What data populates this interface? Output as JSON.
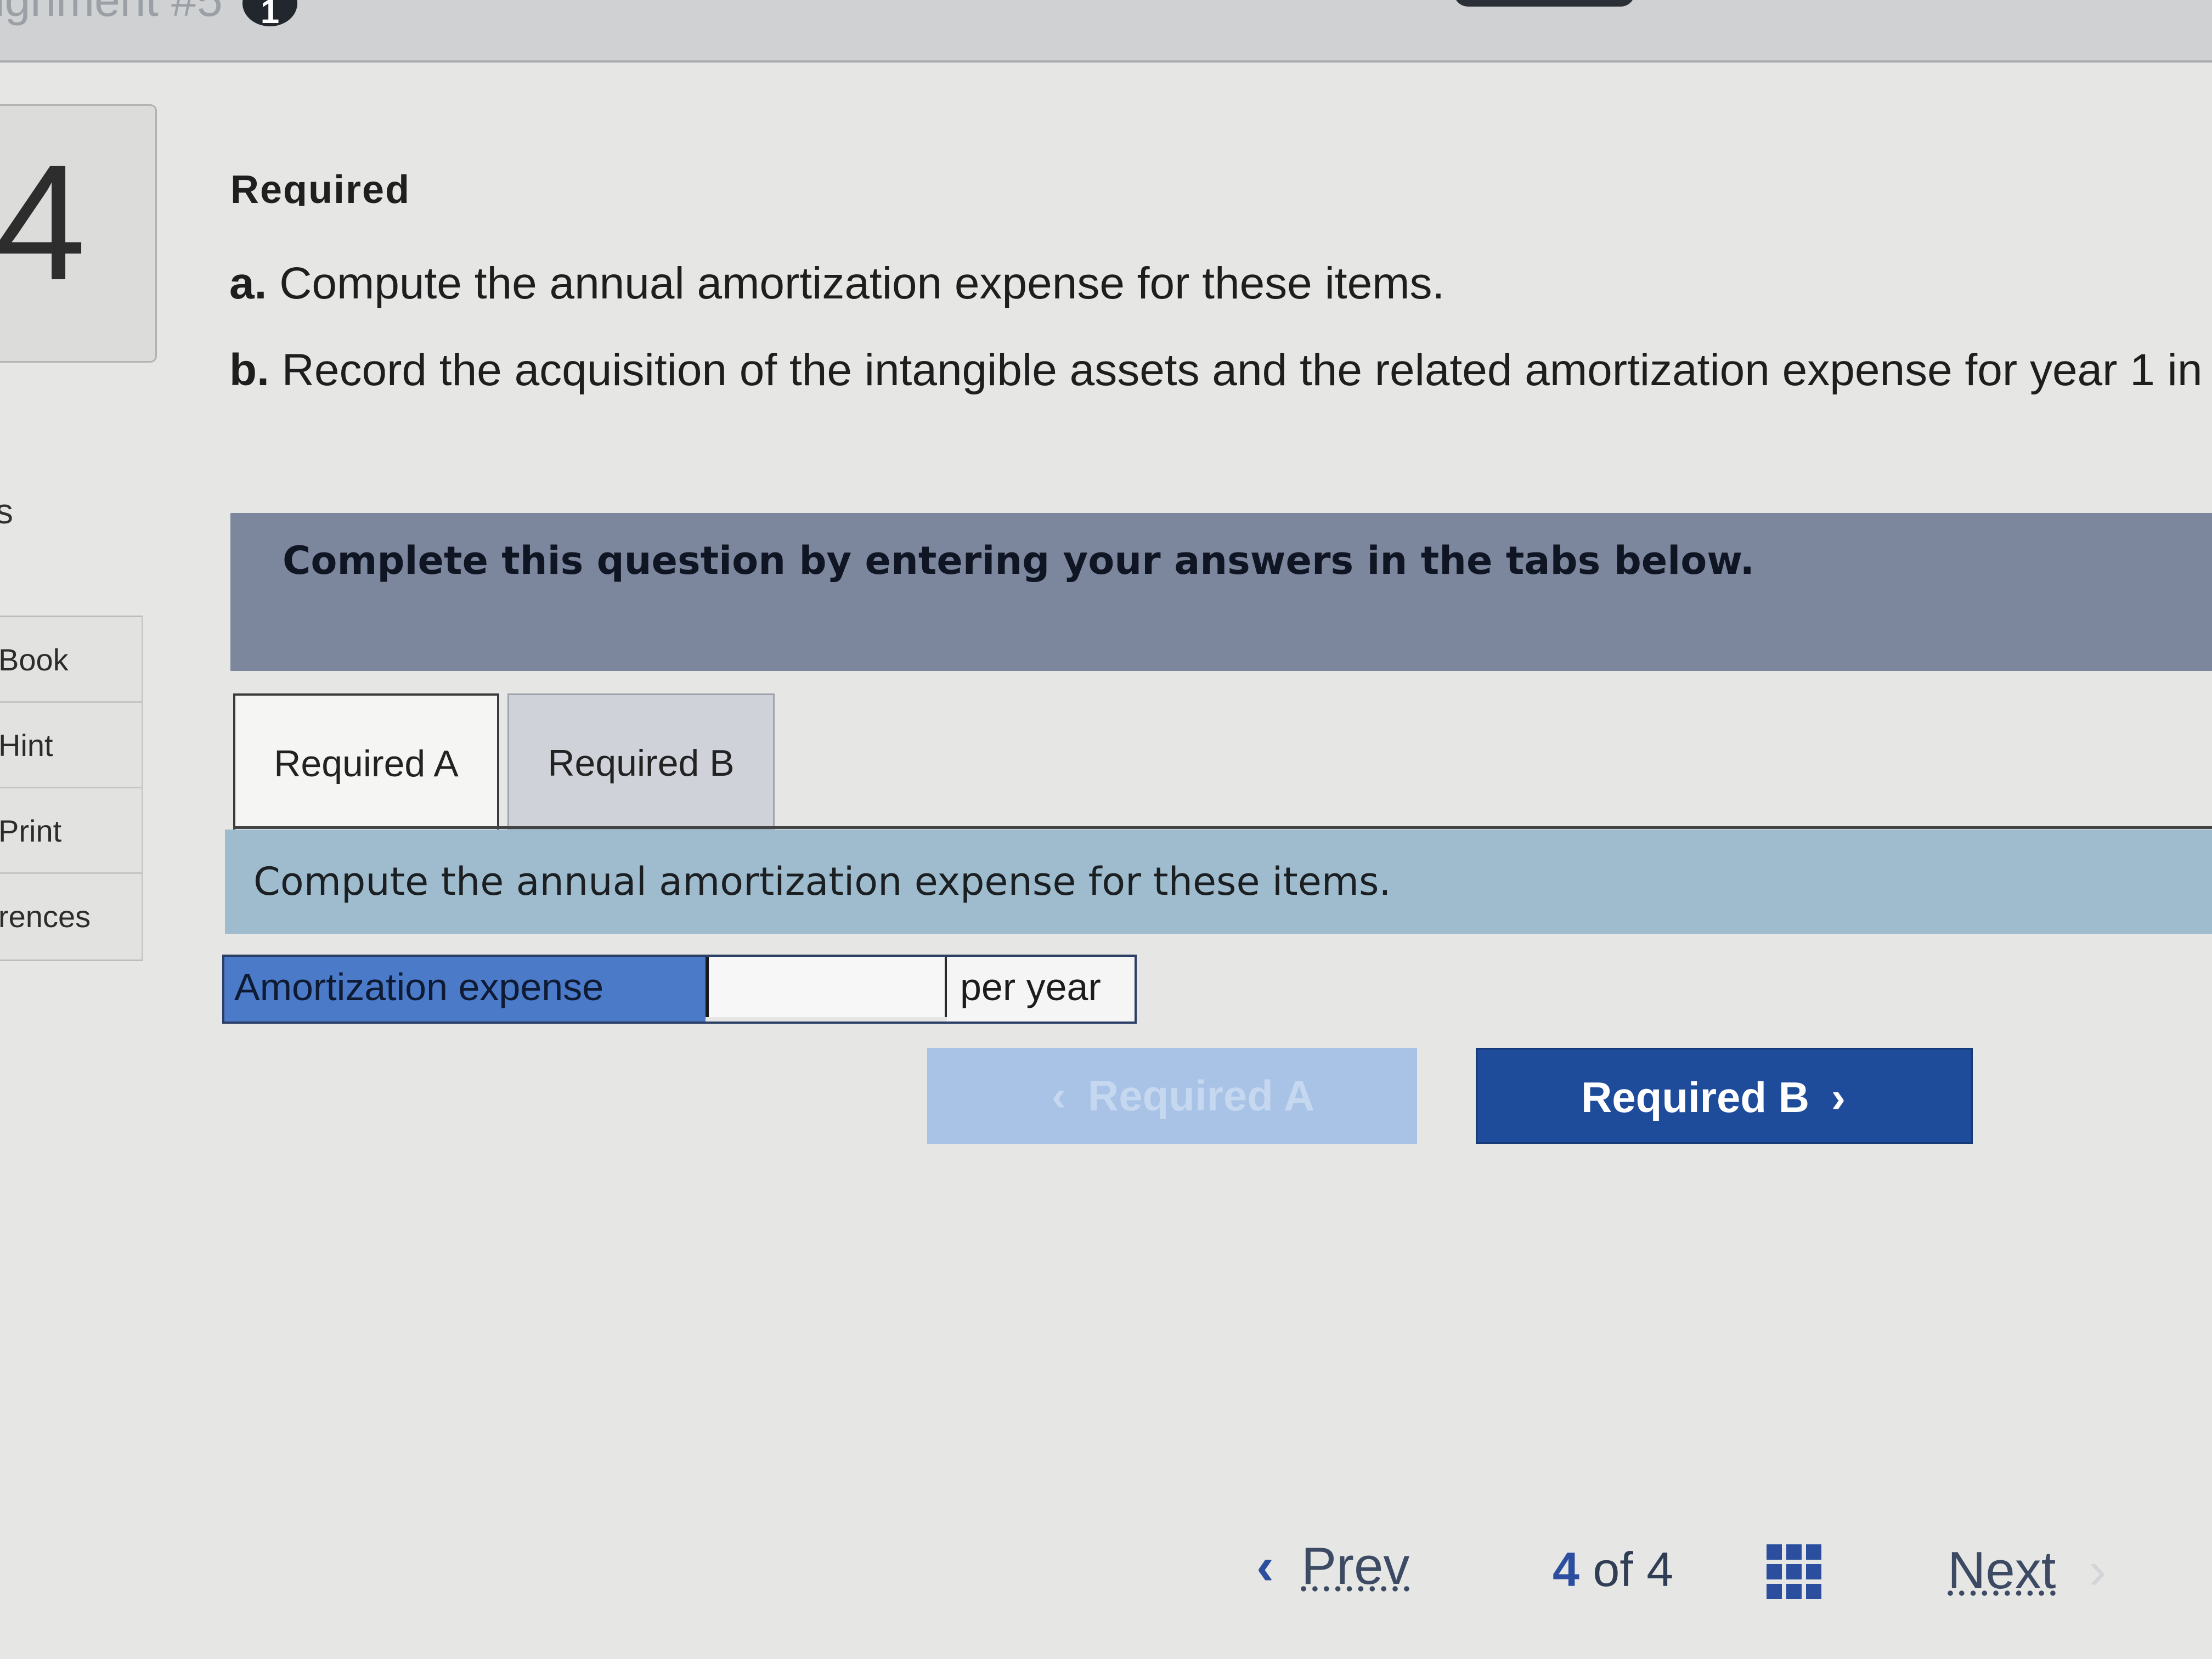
{
  "header": {
    "assignment_title": "ignment #5",
    "info_icon": "1"
  },
  "question": {
    "number": "4"
  },
  "sidebar": {
    "partial_label": "s",
    "items": [
      {
        "label": "Book"
      },
      {
        "label": "Hint"
      },
      {
        "label": "Print"
      },
      {
        "label": "rences"
      }
    ]
  },
  "content": {
    "heading": "Required",
    "req_a_prefix": "a.",
    "req_a_text": "Compute the annual amortization expense for these items.",
    "req_b_prefix": "b.",
    "req_b_text": "Record the acquisition of the intangible assets and the related amortization expense for year 1 in"
  },
  "banner": {
    "text": "Complete this question by entering your answers in the tabs below."
  },
  "tabs": [
    {
      "label": "Required A",
      "active": true
    },
    {
      "label": "Required B",
      "active": false
    }
  ],
  "panel": {
    "instruction": "Compute the annual amortization expense for these items.",
    "row_label": "Amortization expense",
    "input_value": "",
    "unit": "per year"
  },
  "nav_buttons": {
    "prev_label": "Required A",
    "next_label": "Required B"
  },
  "footer": {
    "prev_label": "Prev",
    "current_page": "4",
    "of_text": "of",
    "total_pages": "4",
    "next_label": "Next"
  },
  "icons": {
    "left_chevron": "‹",
    "right_chevron": "›"
  },
  "colors": {
    "banner_bg": "#7c879e",
    "instruction_bg": "#9fbccf",
    "label_bg": "#4a7ac8",
    "primary_button": "#1f4c9a",
    "disabled_button": "#a9c3e6"
  }
}
